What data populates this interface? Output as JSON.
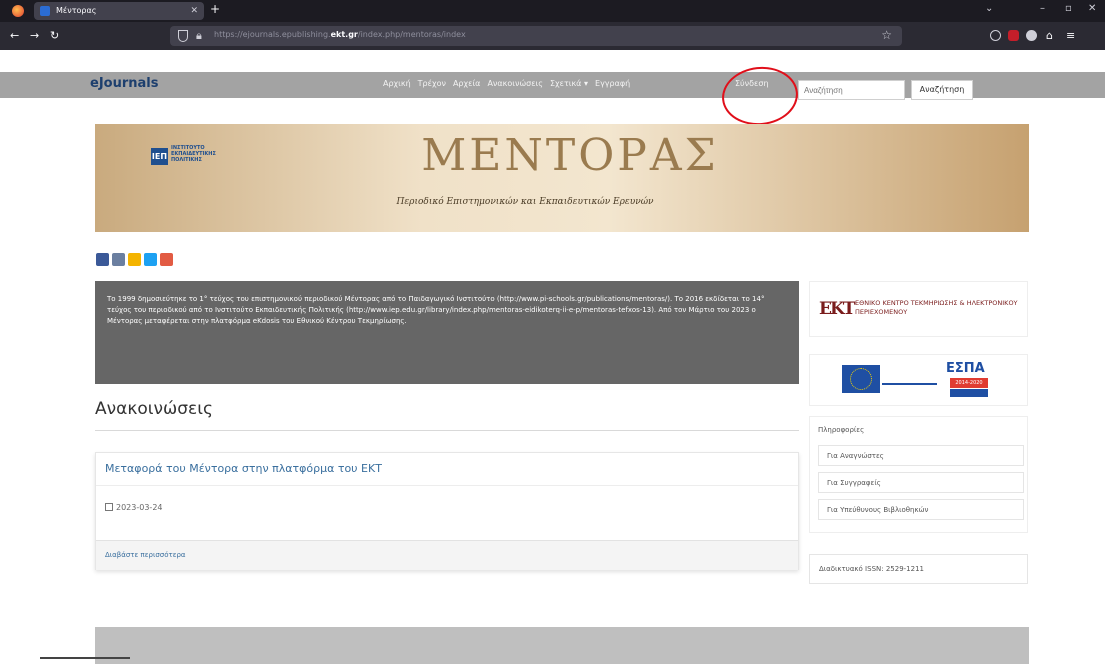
{
  "browser": {
    "tab_title": "Μέντορας",
    "url_prefix": "https://ejournals.epublishing.",
    "url_domain": "ekt.gr",
    "url_suffix": "/index.php/mentoras/index"
  },
  "site": {
    "brand": "eJournals",
    "nav": [
      "Αρχική",
      "Τρέχον",
      "Αρχεία",
      "Ανακοινώσεις",
      "Σχετικά ▾",
      "Εγγραφή"
    ],
    "login_label": "Σύνδεση",
    "search_placeholder": "Αναζήτηση",
    "search_button": "Αναζήτηση"
  },
  "banner": {
    "institute": "ΙΝΣΤΙΤΟΥΤΟ ΕΚΠΑΙΔΕΥΤΙΚΗΣ ΠΟΛΙΤΙΚΗΣ",
    "iep_abbr": "ΙΕΠ",
    "title": "ΜΕΝΤΟΡΑΣ",
    "subtitle": "Περιοδικό Επιστημονικών και Εκπαιδευτικών Ερευνών"
  },
  "intro": {
    "text": "Το 1999 δημοσιεύτηκε το 1° τεύχος του επιστημονικού περιοδικού Μέντορας από το Παιδαγωγικό Ινστιτούτο (http://www.pi-schools.gr/publications/mentoras/). Το 2016 εκδίδεται το 14° τεύχος του περιοδικού από το Ινστιτούτο Εκπαιδευτικής Πολιτικής (http://www.iep.edu.gr/library/index.php/mentoras-eidikoterq-ii-e-p/mentoras-tefxos-13). Από τον Μάρτιο του 2023 ο Μέντορας μεταφέρεται στην πλατφόρμα eKdosis του Εθνικού Κέντρου Τεκμηρίωσης."
  },
  "announcements": {
    "heading": "Ανακοινώσεις",
    "items": [
      {
        "title": "Μεταφορά του Μέντορα στην πλατφόρμα του ΕΚΤ",
        "date": "2023-03-24",
        "read_more": "Διαβάστε περισσότερα"
      }
    ]
  },
  "sidebar": {
    "ekt_logo": "EKT",
    "ekt_name": "ΕΘΝΙΚΟ ΚΕΝΤΡΟ ΤΕΚΜΗΡΙΩΣΗΣ & ΗΛΕΚΤΡΟΝΙΚΟΥ ΠΕΡΙΕΧΟΜΕΝΟΥ",
    "espa_label": "ΕΣΠΑ",
    "espa_years": "2014-2020",
    "info_title": "Πληροφορίες",
    "info_items": [
      "Για Αναγνώστες",
      "Για Συγγραφείς",
      "Για Υπεύθυνους Βιβλιοθηκών"
    ],
    "issn": "Διαδικτυακό ISSN: 2529-1211"
  },
  "colors": {
    "annotation": "#e00f1a",
    "link": "#3a6f9e"
  }
}
